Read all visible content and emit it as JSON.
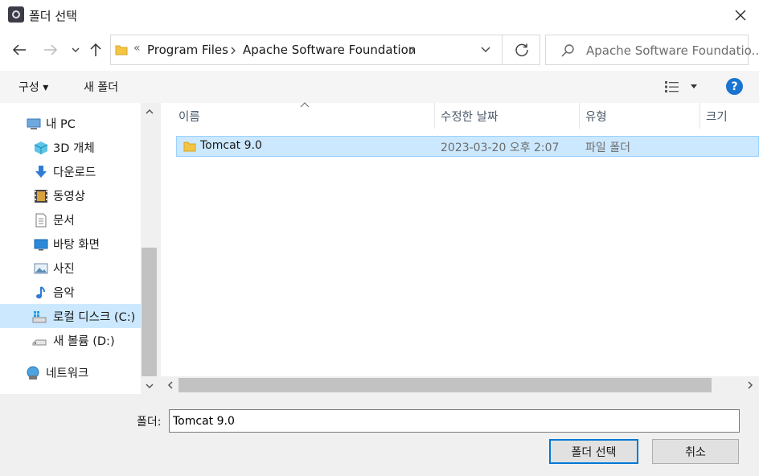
{
  "window": {
    "title": "폴더 선택"
  },
  "navigation": {
    "breadcrumb_overflow": "«",
    "breadcrumb": [
      "Program Files",
      "Apache Software Foundation"
    ],
    "search_placeholder": "Apache Software Foundatio..."
  },
  "toolbar": {
    "organize": "구성 ▾",
    "new_folder": "새 폴더",
    "help": "?"
  },
  "sidebar": {
    "items": [
      {
        "label": "내 PC",
        "icon": "pc-icon"
      },
      {
        "label": "3D 개체",
        "icon": "3d-objects-icon"
      },
      {
        "label": "다운로드",
        "icon": "download-icon"
      },
      {
        "label": "동영상",
        "icon": "video-icon"
      },
      {
        "label": "문서",
        "icon": "document-icon"
      },
      {
        "label": "바탕 화면",
        "icon": "desktop-icon"
      },
      {
        "label": "사진",
        "icon": "picture-icon"
      },
      {
        "label": "음악",
        "icon": "music-icon"
      },
      {
        "label": "로컬 디스크 (C:)",
        "icon": "drive-c-icon"
      },
      {
        "label": "새 볼륨 (D:)",
        "icon": "drive-icon"
      },
      {
        "label": "네트워크",
        "icon": "network-icon"
      }
    ]
  },
  "file_list": {
    "columns": [
      "이름",
      "수정한 날짜",
      "유형",
      "크기"
    ],
    "rows": [
      {
        "name": "Tomcat 9.0",
        "modified": "2023-03-20 오후 2:07",
        "type": "파일 폴더"
      }
    ]
  },
  "footer": {
    "folder_label": "폴더:",
    "folder_value": "Tomcat 9.0",
    "select_button": "폴더 선택",
    "cancel_button": "취소"
  },
  "colors": {
    "accent": "#0078d7",
    "selection": "#cce8ff",
    "folder": "#f3c544"
  }
}
